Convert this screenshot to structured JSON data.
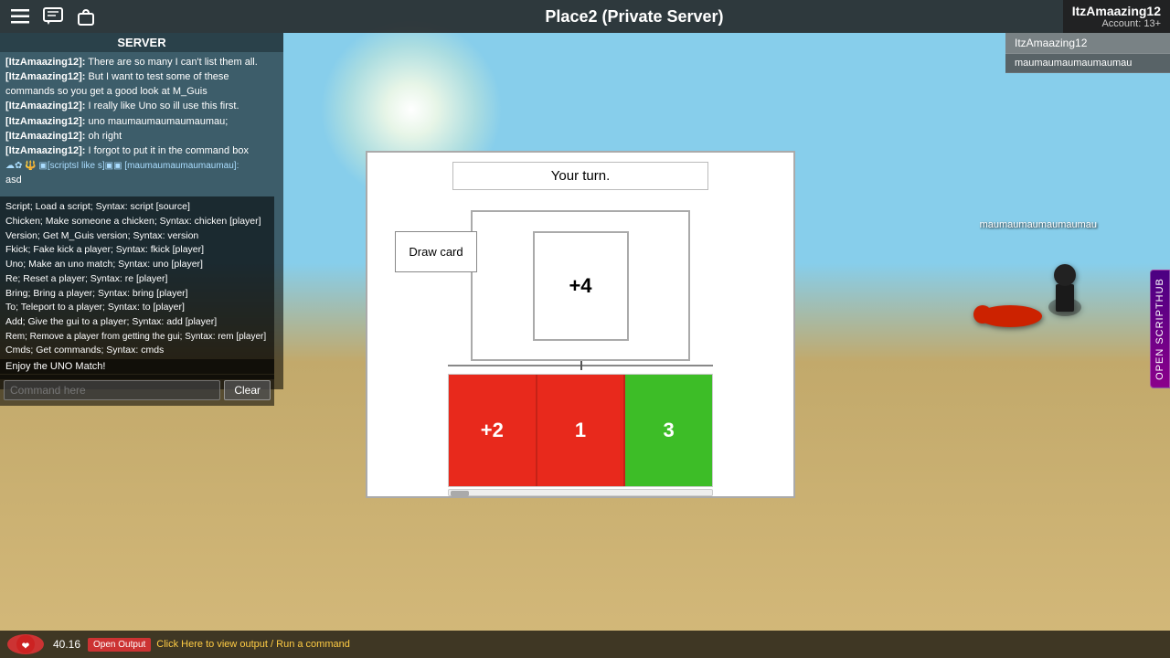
{
  "topbar": {
    "title": "Place2 (Private Server)",
    "menu_icon": "☰",
    "chat_icon": "💬",
    "bag_icon": "🎒"
  },
  "player_info": {
    "username": "ItzAmaazing12",
    "account": "Account: 13+"
  },
  "player_list": [
    {
      "name": "ItzAmaazing12",
      "active": true
    },
    {
      "name": "maumaumaumaumaumau",
      "active": false
    }
  ],
  "server_label": "SERVER",
  "chat": [
    {
      "username": "[ItzAmaazing12]:",
      "message": " There are so many I can't list them all."
    },
    {
      "username": "[ItzAmaazing12]:",
      "message": " But I want to test some of these commands so you get a good look at M_Guis"
    },
    {
      "username": "[ItzAmaazing12]:",
      "message": " I really like Uno so ill use this first."
    },
    {
      "username": "[ItzAmaazing12]:",
      "message": " uno maumaumaumaumaumau;"
    },
    {
      "username": "[ItzAmaazing12]:",
      "message": " oh right"
    },
    {
      "username": "[ItzAmaazing12]:",
      "message": " I forgot to put it in the command box"
    },
    {
      "prefix": "☁✿ 🔱 ▣[scriptsI like s]▣▣ [maumaumaumaumaumau]:",
      "message": ""
    }
  ],
  "input_text": "asd",
  "script_list": [
    "Script; Load a script; Syntax: script [source]",
    "Chicken; Make someone a chicken; Syntax: chicken [player]",
    "Version; Get M_Guis version; Syntax: version",
    "Fkick; Fake kick a player; Syntax: fkick [player]",
    "Uno; Make an uno match; Syntax: uno [player]",
    "Re; Reset a player; Syntax: re [player]",
    "Bring; Bring a player; Syntax: bring [player]",
    "To; Teleport to a player; Syntax: to [player]",
    "Add; Give the gui to a player; Syntax: add [player]",
    "Rem; Remove a player from getting the gui; Syntax: rem [player]",
    "Cmds; Get commands; Syntax: cmds"
  ],
  "enjoy_text": "Enjoy the UNO Match!",
  "command_placeholder": "Command here",
  "clear_button": "Clear",
  "uno": {
    "turn_text": "Your turn.",
    "draw_card_label": "Draw card",
    "center_card_value": "+4",
    "hand_cards": [
      {
        "color": "red",
        "value": "+2"
      },
      {
        "color": "red",
        "value": "1"
      },
      {
        "color": "green",
        "value": "3"
      }
    ]
  },
  "character_label": "maumaumaumaumaumau",
  "health": {
    "icon": "❤",
    "value": "40.16"
  },
  "notification": {
    "badge": "Open Output",
    "text": "Click Here to view output / Run a command"
  },
  "script_hub_label": "OPEN SCRIPTHUB"
}
